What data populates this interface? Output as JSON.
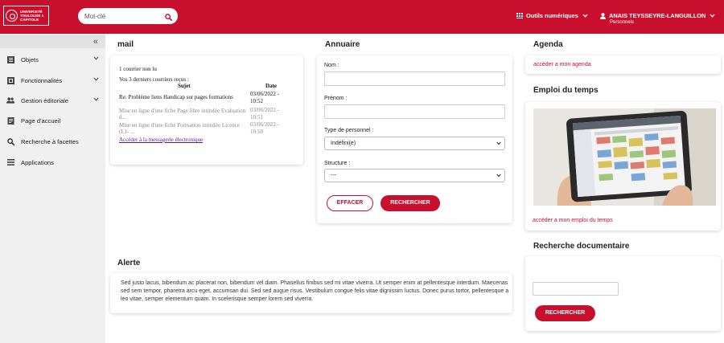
{
  "header": {
    "logo_lines": [
      "Université",
      "Toulouse 1",
      "Capitole"
    ],
    "search_placeholder": "Mot-clé",
    "tools_label": "Outils numériques",
    "user_name": "ANAIS TEYSSEYRE-LANGUILLON",
    "user_role": "Personnels"
  },
  "sidebar": {
    "items": [
      {
        "label": "Objets",
        "icon": "archive-icon",
        "has_submenu": true
      },
      {
        "label": "Fonctionnalités",
        "icon": "database-icon",
        "has_submenu": true
      },
      {
        "label": "Gestion éditoriale",
        "icon": "users-icon",
        "has_submenu": true
      },
      {
        "label": "Page d'accueil",
        "icon": "page-icon",
        "has_submenu": false
      },
      {
        "label": "Recherche à facettes",
        "icon": "search-icon",
        "has_submenu": false
      },
      {
        "label": "Applications",
        "icon": "list-icon",
        "has_submenu": false
      }
    ]
  },
  "mail": {
    "title": "mail",
    "unread": "1 courrier non lu",
    "recent": "Vos 3 derniers courriers reçus :",
    "col_subject": "Sujet",
    "col_date": "Date",
    "rows": [
      {
        "subject": "Re: Problème liens Handicap sur pages formations",
        "date": "03/06/2022 - 10:52",
        "unread": true
      },
      {
        "subject": "Mise en ligne d'une fiche Page libre intitulée Evaluation d...",
        "date": "03/06/2022 - 10:51",
        "unread": false
      },
      {
        "subject": "Mise en ligne d'une fiche Formation intitulée Licence (L1- ...",
        "date": "03/06/2022 - 10:50",
        "unread": false
      }
    ],
    "link": "Accéder à la messagerie électronique"
  },
  "annuaire": {
    "title": "Annuaire",
    "nom_label": "Nom :",
    "prenom_label": "Prénom :",
    "type_label": "Type de personnel :",
    "type_value": "Indéfini(e)",
    "structure_label": "Structure :",
    "structure_value": "---",
    "clear_label": "EFFACER",
    "search_label": "RECHERCHER"
  },
  "agenda": {
    "title": "Agenda",
    "link": "accéder a mon agenda"
  },
  "emploi": {
    "title": "Emploi du temps",
    "link": "accéder a mon emploi du temps"
  },
  "alerte": {
    "title": "Alerte",
    "text": "Sed justo lacus, bibendum ac placerat non, bibendum vel diam. Phasellus finibus sed mi vitae viverra. Ut semper enim at pellentesque interdum. Maecenas sed sem tempor, pharetra arcu eget, accumsan dui. Sed sed augue risus. Vestibulum congue felis vitae dignissim luctus. Donec purus tortor, pellentesque a leo vitae, semper elementum quam. In scelerisque semper lorem sed viverra."
  },
  "recherche_doc": {
    "title": "Recherche documentaire",
    "search_label": "RECHERCHER"
  },
  "colors": {
    "brand": "#c8102e",
    "sidebar_bg": "#f0f0f0"
  }
}
